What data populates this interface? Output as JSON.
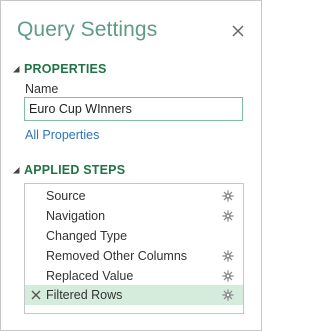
{
  "panel": {
    "title": "Query Settings",
    "close_icon": "close-icon"
  },
  "properties": {
    "header": "PROPERTIES",
    "name_label": "Name",
    "name_value": "Euro Cup WInners",
    "all_properties_link": "All Properties"
  },
  "applied_steps": {
    "header": "APPLIED STEPS",
    "steps": [
      {
        "label": "Source",
        "has_settings": true,
        "selected": false
      },
      {
        "label": "Navigation",
        "has_settings": true,
        "selected": false
      },
      {
        "label": "Changed Type",
        "has_settings": false,
        "selected": false
      },
      {
        "label": "Removed Other Columns",
        "has_settings": true,
        "selected": false
      },
      {
        "label": "Replaced Value",
        "has_settings": true,
        "selected": false
      },
      {
        "label": "Filtered Rows",
        "has_settings": true,
        "selected": true,
        "has_delete": true
      }
    ]
  },
  "colors": {
    "title": "#5f9c84",
    "section_header": "#217346",
    "link": "#2e75b6",
    "selected_step_bg": "#d5ecdd",
    "input_border": "#7fbf9f"
  }
}
